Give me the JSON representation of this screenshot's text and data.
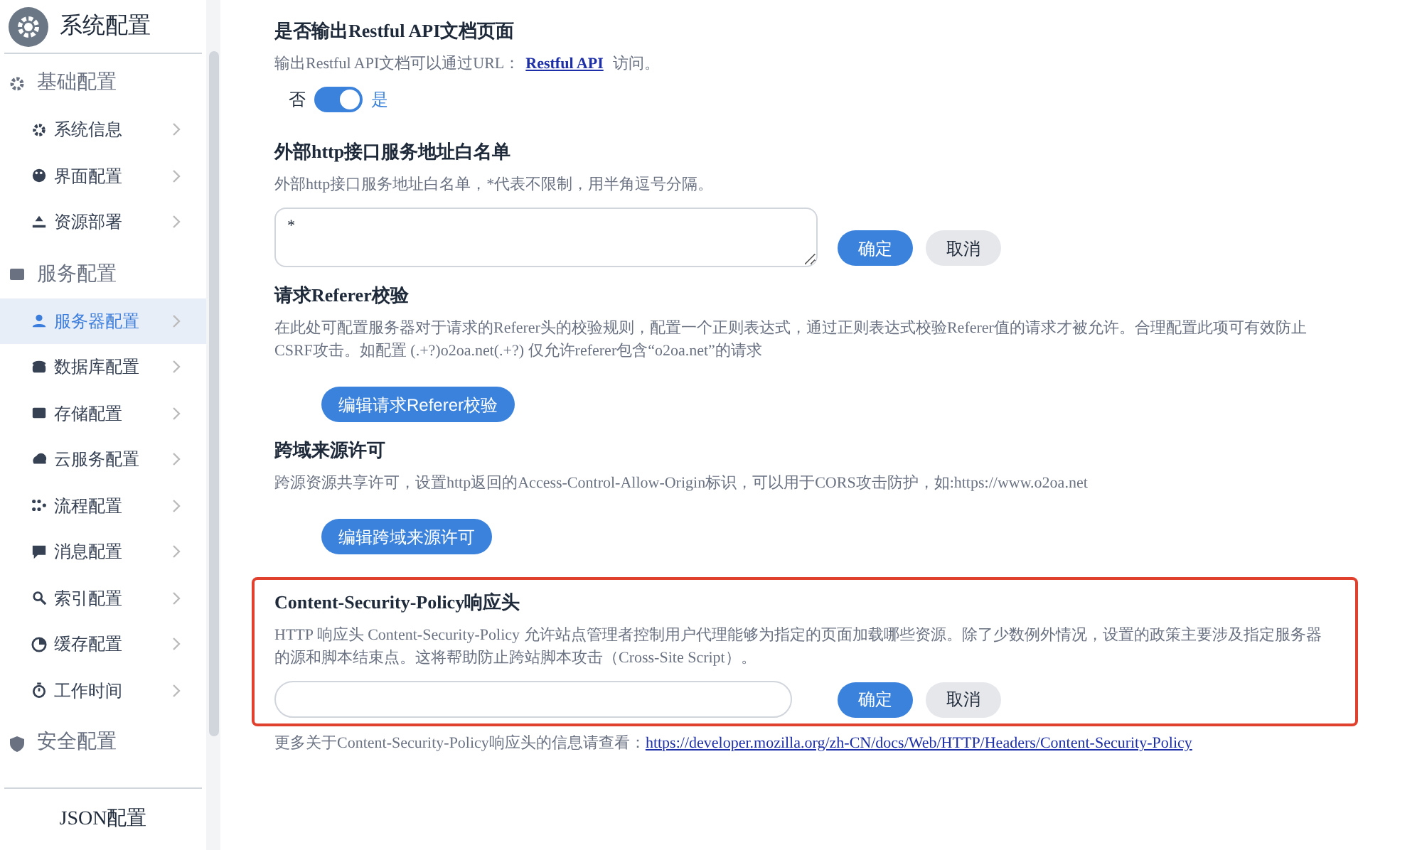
{
  "sidebar": {
    "title": "系统配置",
    "items": [
      {
        "kind": "group",
        "label": "基础配置",
        "selected": false
      },
      {
        "kind": "item",
        "label": "系统信息",
        "selected": false
      },
      {
        "kind": "item",
        "label": "界面配置",
        "selected": false
      },
      {
        "kind": "item",
        "label": "资源部署",
        "selected": false
      },
      {
        "kind": "group",
        "label": "服务配置",
        "selected": false
      },
      {
        "kind": "item",
        "label": "服务器配置",
        "selected": true
      },
      {
        "kind": "item",
        "label": "数据库配置",
        "selected": false
      },
      {
        "kind": "item",
        "label": "存储配置",
        "selected": false
      },
      {
        "kind": "item",
        "label": "云服务配置",
        "selected": false
      },
      {
        "kind": "item",
        "label": "流程配置",
        "selected": false
      },
      {
        "kind": "item",
        "label": "消息配置",
        "selected": false
      },
      {
        "kind": "item",
        "label": "索引配置",
        "selected": false
      },
      {
        "kind": "item",
        "label": "缓存配置",
        "selected": false
      },
      {
        "kind": "item",
        "label": "工作时间",
        "selected": false
      },
      {
        "kind": "group",
        "label": "安全配置",
        "selected": false
      }
    ],
    "footer": "JSON配置"
  },
  "sections": [
    {
      "kind": "toggle",
      "title": "是否输出Restful API文档页面",
      "description": "输出Restful API文档可以通过URL：",
      "link": "Restful API",
      "description_after": " 访问。",
      "off_label": "否",
      "on_label": "是",
      "on": true,
      "highlighted": false
    },
    {
      "kind": "textarea",
      "title": "外部http接口服务地址白名单",
      "description": "外部http接口服务地址白名单，*代表不限制，用半角逗号分隔。",
      "value": "*",
      "buttons": [
        "确定",
        "取消"
      ],
      "highlighted": false
    },
    {
      "kind": "button",
      "title": "请求Referer校验",
      "description": "在此处可配置服务器对于请求的Referer头的校验规则，配置一个正则表达式，通过正则表达式校验Referer值的请求才被允许。合理配置此项可有效防止CSRF攻击。如配置 (.+?)o2oa.net(.+?) 仅允许referer包含“o2oa.net”的请求",
      "button": "编辑请求Referer校验",
      "highlighted": false
    },
    {
      "kind": "button",
      "title": "跨域来源许可",
      "description": "跨源资源共享许可，设置http返回的Access-Control-Allow-Origin标识，可以用于CORS攻击防护，如:https://www.o2oa.net",
      "button": "编辑跨域来源许可",
      "highlighted": false
    },
    {
      "kind": "input",
      "title": "Content-Security-Policy响应头",
      "description": "HTTP 响应头 Content-Security-Policy 允许站点管理者控制用户代理能够为指定的页面加载哪些资源。除了少数例外情况，设置的政策主要涉及指定服务器的源和脚本结束点。这将帮助防止跨站脚本攻击（Cross-Site Script）。",
      "buttons": [
        "确定",
        "取消"
      ],
      "highlighted": true
    }
  ],
  "footnote": {
    "text": "更多关于Content-Security-Policy响应头的信息请查看：",
    "link": "https://developer.mozilla.org/zh-CN/docs/Web/HTTP/Headers/Content-Security-Policy"
  }
}
